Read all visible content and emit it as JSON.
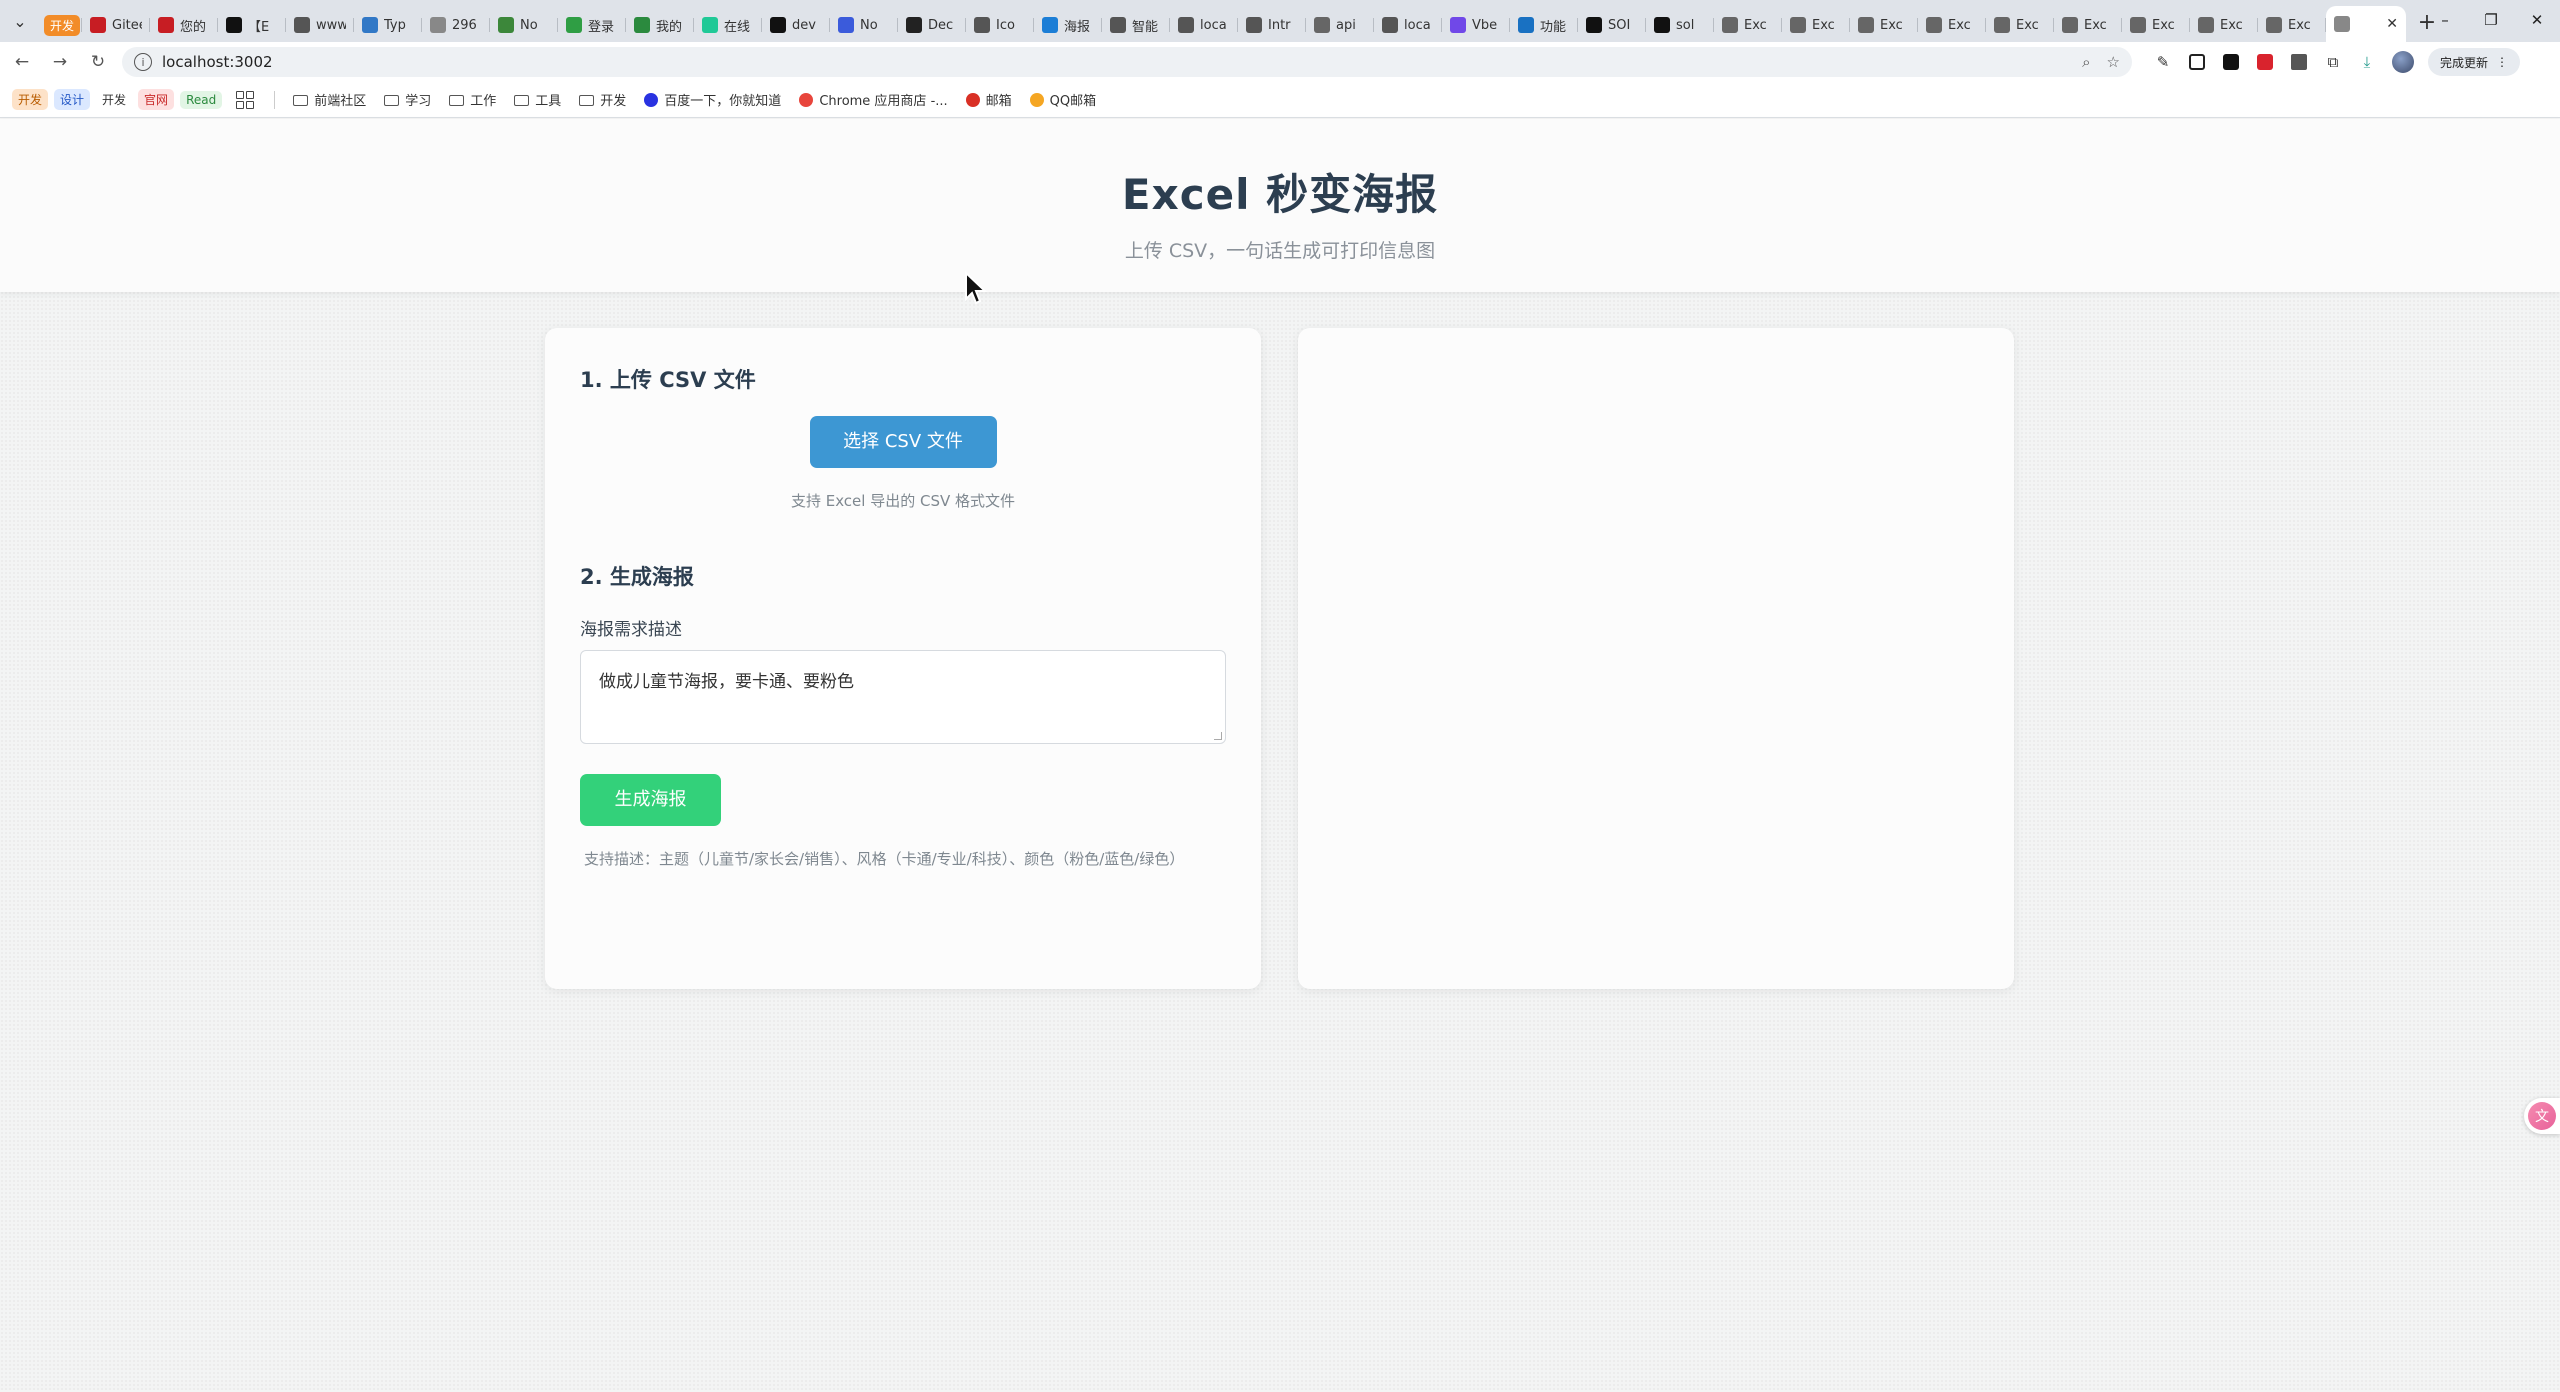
{
  "browser": {
    "tab_group": "开发",
    "tabs": [
      {
        "title": "Gitee",
        "icon": "gitee-icon",
        "color": "#c71d23"
      },
      {
        "title": "您的",
        "icon": "gitee-icon",
        "color": "#c71d23"
      },
      {
        "title": "【E",
        "icon": "notion-icon",
        "color": "#111111"
      },
      {
        "title": "www",
        "icon": "link-icon",
        "color": "#555555"
      },
      {
        "title": "Typ",
        "icon": "typescript-icon",
        "color": "#3178c6"
      },
      {
        "title": "296",
        "icon": "github-icon",
        "color": "#888888"
      },
      {
        "title": "No",
        "icon": "node-icon",
        "color": "#3c873a"
      },
      {
        "title": "登录",
        "icon": "doc-icon",
        "color": "#2f9e44"
      },
      {
        "title": "我的",
        "icon": "leaf-icon",
        "color": "#2b8a3e"
      },
      {
        "title": "在线",
        "icon": "chat-icon",
        "color": "#20c997"
      },
      {
        "title": "dev",
        "icon": "medium-icon",
        "color": "#111111"
      },
      {
        "title": "No",
        "icon": "shield-icon",
        "color": "#3b5bdb"
      },
      {
        "title": "Dec",
        "icon": "deepseek-icon",
        "color": "#222222"
      },
      {
        "title": "Ico",
        "icon": "iconfont-icon",
        "color": "#555555"
      },
      {
        "title": "海报",
        "icon": "app-icon",
        "color": "#1c7ed6"
      },
      {
        "title": "智能",
        "icon": "ai-icon",
        "color": "#555555"
      },
      {
        "title": "loca",
        "icon": "ai-icon",
        "color": "#555555"
      },
      {
        "title": "Intr",
        "icon": "ai-icon",
        "color": "#555555"
      },
      {
        "title": "api",
        "icon": "globe-icon",
        "color": "#666666"
      },
      {
        "title": "loca",
        "icon": "ai-icon",
        "color": "#555555"
      },
      {
        "title": "Vbe",
        "icon": "vibe-icon",
        "color": "#7048e8"
      },
      {
        "title": "功能",
        "icon": "pin-icon",
        "color": "#1971c2"
      },
      {
        "title": "SOI",
        "icon": "terminal-icon",
        "color": "#111111"
      },
      {
        "title": "sol",
        "icon": "terminal-icon",
        "color": "#111111"
      },
      {
        "title": "Exc",
        "icon": "globe-icon",
        "color": "#666666"
      },
      {
        "title": "Exc",
        "icon": "globe-icon",
        "color": "#666666"
      },
      {
        "title": "Exc",
        "icon": "globe-icon",
        "color": "#666666"
      },
      {
        "title": "Exc",
        "icon": "globe-icon",
        "color": "#666666"
      },
      {
        "title": "Exc",
        "icon": "globe-icon",
        "color": "#666666"
      },
      {
        "title": "Exc",
        "icon": "globe-icon",
        "color": "#666666"
      },
      {
        "title": "Exc",
        "icon": "globe-icon",
        "color": "#666666"
      },
      {
        "title": "Exc",
        "icon": "globe-icon",
        "color": "#666666"
      },
      {
        "title": "Exc",
        "icon": "globe-icon",
        "color": "#666666"
      }
    ],
    "url": "localhost:3002",
    "finish_label": "完成更新",
    "bookmarks_chips": [
      {
        "label": "开发",
        "bg": "#fde2c8",
        "fg": "#b85c00"
      },
      {
        "label": "设计",
        "bg": "#dbe8ff",
        "fg": "#2458c6"
      },
      {
        "label": "开发",
        "bg": "#ffffff",
        "fg": "#333333"
      },
      {
        "label": "官网",
        "bg": "#fde0e0",
        "fg": "#c92a2a"
      },
      {
        "label": "Read",
        "bg": "#e2f5e5",
        "fg": "#2b8a3e"
      }
    ],
    "bookmarks": [
      {
        "label": "前端社区",
        "type": "folder"
      },
      {
        "label": "学习",
        "type": "folder"
      },
      {
        "label": "工作",
        "type": "folder"
      },
      {
        "label": "工具",
        "type": "folder"
      },
      {
        "label": "开发",
        "type": "folder"
      },
      {
        "label": "百度一下，你就知道",
        "type": "site",
        "icon": "baidu-icon"
      },
      {
        "label": "Chrome 应用商店 -...",
        "type": "site",
        "icon": "chrome-store-icon"
      },
      {
        "label": "邮箱",
        "type": "site",
        "icon": "gmail-icon"
      },
      {
        "label": "QQ邮箱",
        "type": "site",
        "icon": "qqmail-icon"
      }
    ]
  },
  "header": {
    "title": "Excel 秒变海报",
    "subtitle": "上传 CSV，一句话生成可打印信息图"
  },
  "upload": {
    "section_title": "1. 上传 CSV 文件",
    "button_label": "选择 CSV 文件",
    "hint": "支持 Excel 导出的 CSV 格式文件"
  },
  "generate": {
    "section_title": "2. 生成海报",
    "field_label": "海报需求描述",
    "textarea_value": "做成儿童节海报，要卡通、要粉色",
    "button_label": "生成海报",
    "hint": "支持描述：主题（儿童节/家长会/销售）、风格（卡通/专业/科技）、颜色（粉色/蓝色/绿色）"
  },
  "colors": {
    "upload_button": "#3d97d3",
    "generate_button": "#33d17a",
    "title": "#2c3e50"
  }
}
